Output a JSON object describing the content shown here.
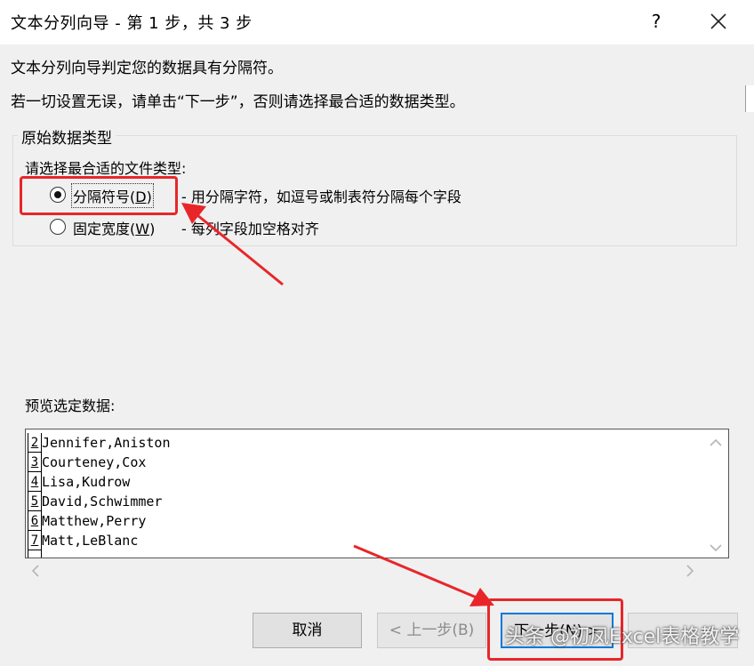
{
  "dialog": {
    "title": "文本分列向导 - 第 1 步，共 3 步",
    "help_label": "?",
    "description_line1": "文本分列向导判定您的数据具有分隔符。",
    "description_line2": "若一切设置无误，请单击“下一步”，否则请选择最合适的数据类型。"
  },
  "data_type_group": {
    "legend": "原始数据类型",
    "prompt": "请选择最合适的文件类型:",
    "options": [
      {
        "label_text": "分隔符号(",
        "accelerator": "D",
        "label_end": ")",
        "hint": "- 用分隔字符，如逗号或制表符分隔每个字段",
        "selected": true
      },
      {
        "label_text": "固定宽度(",
        "accelerator": "W",
        "label_end": ")",
        "hint": "- 每列字段加空格对齐",
        "selected": false
      }
    ]
  },
  "preview": {
    "label": "预览选定数据:",
    "rows": [
      {
        "line": "2",
        "text": "Jennifer,Aniston"
      },
      {
        "line": "3",
        "text": "Courteney,Cox"
      },
      {
        "line": "4",
        "text": "Lisa,Kudrow"
      },
      {
        "line": "5",
        "text": "David,Schwimmer"
      },
      {
        "line": "6",
        "text": "Matthew,Perry"
      },
      {
        "line": "7",
        "text": "Matt,LeBlanc"
      }
    ]
  },
  "buttons": {
    "cancel": "取消",
    "back": "< 上一步(B)",
    "next": "下一步(N) >"
  },
  "watermark": "头条 @初凤Excel表格教学",
  "colors": {
    "highlight": "#e8262a",
    "dialog_bg": "#f0f0f0",
    "primary_border": "#0078d7"
  }
}
